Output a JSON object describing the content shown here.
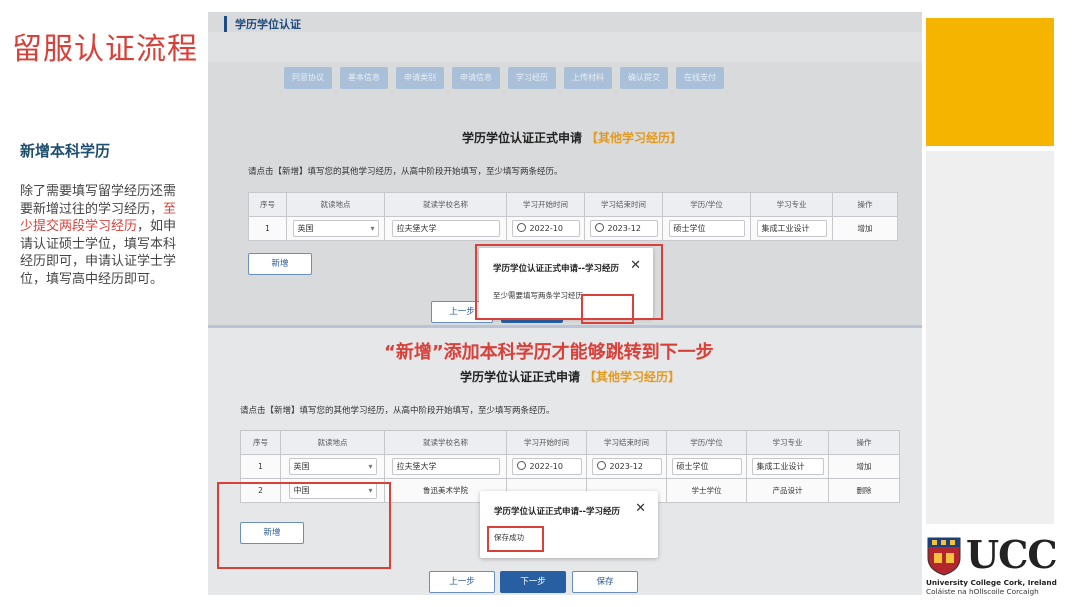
{
  "slide": {
    "title": "留服认证流程",
    "subtitle": "新增本科学历",
    "desc_part1": "除了需要填写留学经历还需要新增过往的学习经历，",
    "desc_highlight": "至少提交两段学习经历",
    "desc_part2": "，如申请认证硕士学位，填写本科经历即可，申请认证学士学位，填写高中经历即可。",
    "caption": "“新增”添加本科学历才能够跳转到下一步"
  },
  "logo": {
    "name": "UCC",
    "line1": "University College Cork, Ireland",
    "line2": "Coláiste na hOllscoile Corcaigh"
  },
  "top": {
    "section_title": "学历学位认证",
    "steps": [
      "同意协议",
      "基本信息",
      "申请类别",
      "申请信息",
      "学习经历",
      "上传材料",
      "确认提交",
      "在线支付"
    ],
    "form_title": "学历学位认证正式申请",
    "form_sub": "【其他学习经历】",
    "hint": "请点击【新增】填写您的其他学习经历，从高中阶段开始填写，至少填写两条经历。",
    "headers": [
      "序号",
      "就读地点",
      "就读学校名称",
      "学习开始时间",
      "学习结束时间",
      "学历/学位",
      "学习专业",
      "操作"
    ],
    "row": {
      "no": "1",
      "place": "英国",
      "school": "拉夫堡大学",
      "start": "2022-10",
      "end": "2023-12",
      "degree": "硕士学位",
      "major": "集成工业设计",
      "op": "增加"
    },
    "add_label": "新增",
    "prev_label": "上一步",
    "modal_title": "学历学位认证正式申请--学习经历",
    "modal_body": "至少需要填写两条学习经历"
  },
  "bottom": {
    "form_title": "学历学位认证正式申请",
    "form_sub": "【其他学习经历】",
    "hint": "请点击【新增】填写您的其他学习经历，从高中阶段开始填写，至少填写两条经历。",
    "headers": [
      "序号",
      "就读地点",
      "就读学校名称",
      "学习开始时间",
      "学习结束时间",
      "学历/学位",
      "学习专业",
      "操作"
    ],
    "row1": {
      "no": "1",
      "place": "英国",
      "school": "拉夫堡大学",
      "start": "2022-10",
      "end": "2023-12",
      "degree": "硕士学位",
      "major": "集成工业设计",
      "op": "增加"
    },
    "row2": {
      "no": "2",
      "place": "中国",
      "school": "鲁迅美术学院",
      "degree": "学士学位",
      "major": "产品设计",
      "op": "删除"
    },
    "add_label": "新增",
    "prev_label": "上一步",
    "next_label": "下一步",
    "save_label": "保存",
    "modal_title": "学历学位认证正式申请--学习经历",
    "modal_body": "保存成功"
  },
  "colors": {
    "accent_red": "#d8403a",
    "brand_yellow": "#f5b400",
    "primary_blue": "#285fa2"
  }
}
